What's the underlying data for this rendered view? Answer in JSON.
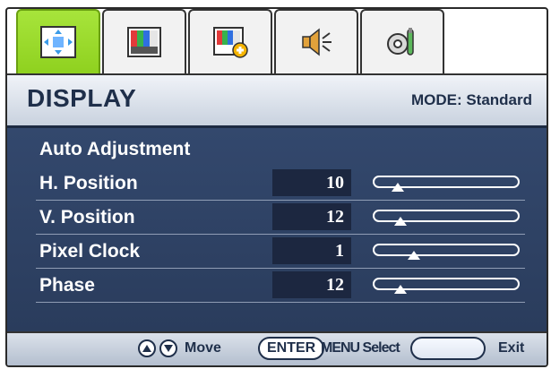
{
  "tabs": [
    {
      "name": "display-tab",
      "icon": "display-arrows-icon",
      "active": true
    },
    {
      "name": "picture-tab",
      "icon": "color-bars-icon",
      "active": false
    },
    {
      "name": "picture-advanced-tab",
      "icon": "color-bars-plus-icon",
      "active": false
    },
    {
      "name": "audio-tab",
      "icon": "speaker-icon",
      "active": false
    },
    {
      "name": "system-tab",
      "icon": "settings-tools-icon",
      "active": false
    }
  ],
  "header": {
    "title": "DISPLAY",
    "mode": "MODE: Standard"
  },
  "menu": {
    "auto_adjustment": "Auto Adjustment",
    "items": [
      {
        "label": "H. Position",
        "value": "10",
        "level": 0.1
      },
      {
        "label": "V. Position",
        "value": "12",
        "level": 0.12
      },
      {
        "label": "Pixel Clock",
        "value": "1",
        "level": 0.23
      },
      {
        "label": "Phase",
        "value": "12",
        "level": 0.12
      }
    ]
  },
  "footer": {
    "move": "Move",
    "enter": "ENTER",
    "select": "MENU Select",
    "exit": "Exit"
  },
  "colors": {
    "accent_green": "#8fd11f",
    "panel_blue": "#2f4468",
    "value_bg": "#1c2740"
  }
}
